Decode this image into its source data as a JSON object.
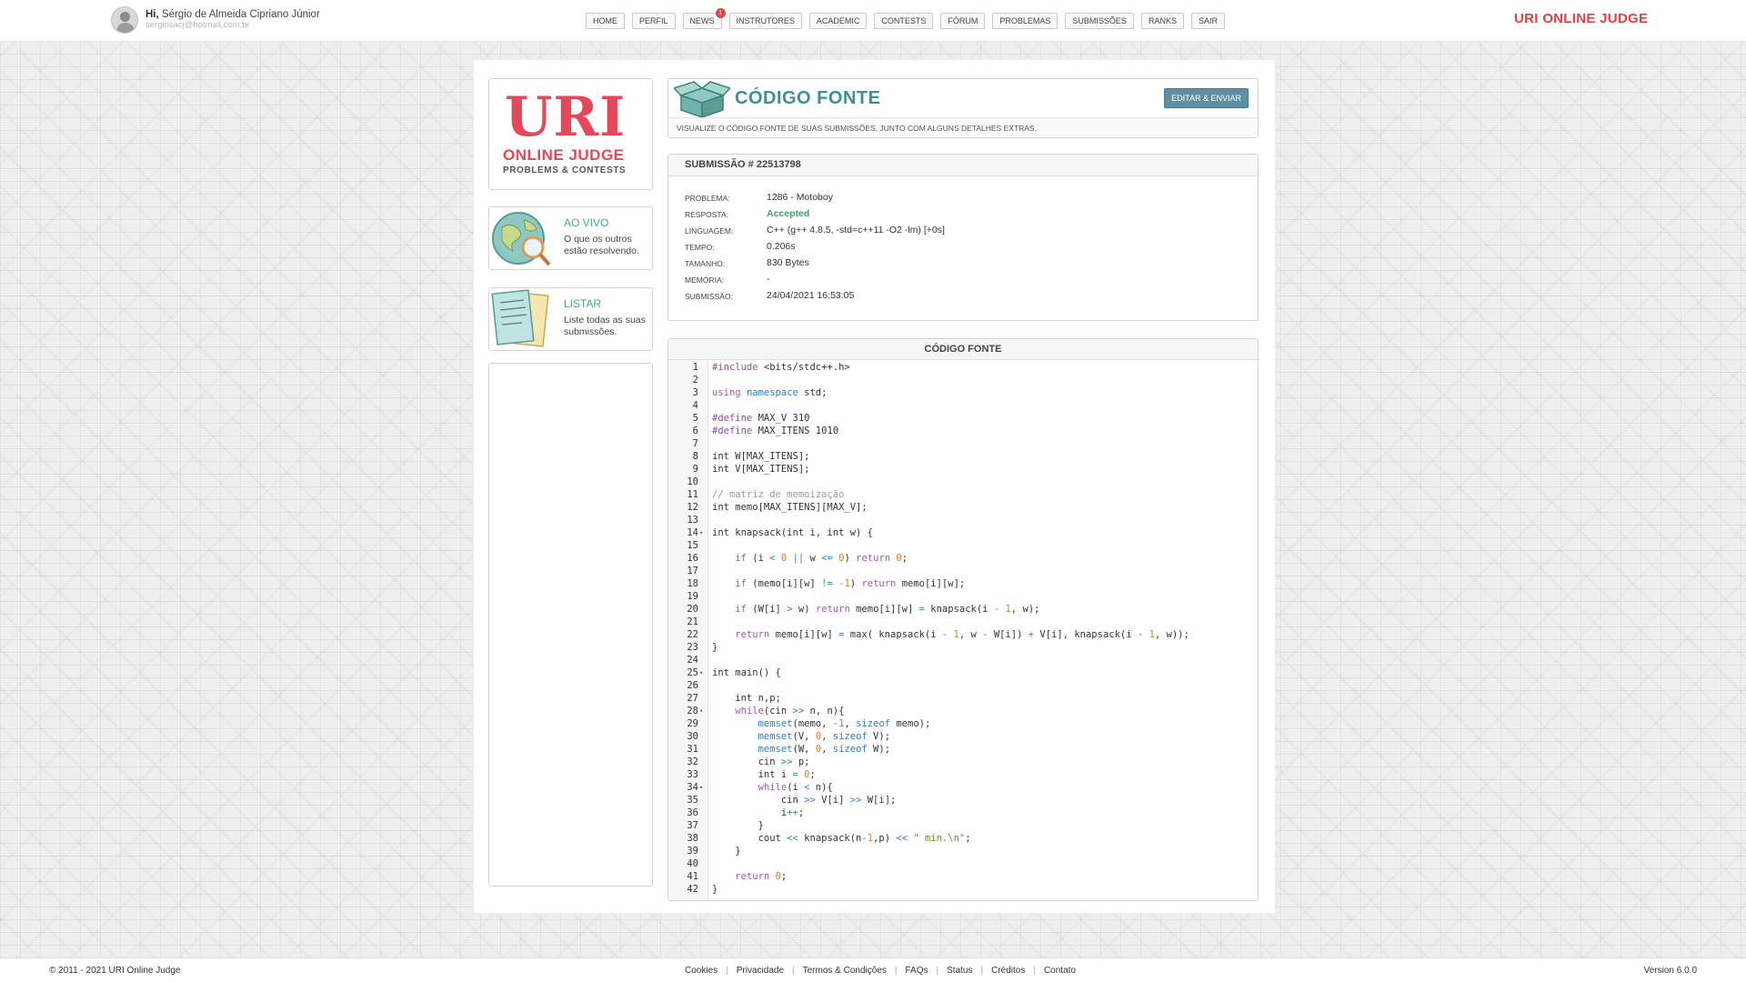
{
  "user": {
    "greeting": "Hi,",
    "name": "Sérgio de Almeida Cipriano Júnior",
    "email": "sergiosacj@hotmail.com.br"
  },
  "nav": {
    "items": [
      {
        "label": "HOME"
      },
      {
        "label": "PERFIL"
      },
      {
        "label": "NEWS",
        "badge": "1"
      },
      {
        "label": "INSTRUTORES"
      },
      {
        "label": "ACADEMIC"
      },
      {
        "label": "CONTESTS"
      },
      {
        "label": "FÓRUM"
      },
      {
        "label": "PROBLEMAS"
      },
      {
        "label": "SUBMISSÕES"
      },
      {
        "label": "RANKS"
      },
      {
        "label": "SAIR"
      }
    ]
  },
  "brand": {
    "top_title": "URI ONLINE JUDGE",
    "color": "#e43f41"
  },
  "logo": {
    "uri": "URI",
    "online_judge": "ONLINE JUDGE",
    "tagline": "PROBLEMS & CONTESTS"
  },
  "sidebar": {
    "live": {
      "title": "AO VIVO",
      "desc": "O que os outros estão resolvendo.",
      "icon": "globe-magnifier-icon"
    },
    "list": {
      "title": "LISTAR",
      "desc": "Liste todas as suas submissões.",
      "icon": "papers-icon"
    }
  },
  "page": {
    "title": "CÓDIGO FONTE",
    "edit_button": "EDITAR & ENVIAR",
    "subtitle": "VISUALIZE O CÓDIGO FONTE DE SUAS SUBMISSÕES, JUNTO COM ALGUNS DETALHES EXTRAS.",
    "title_color": "#3f8f90"
  },
  "submission": {
    "header": "SUBMISSÃO # 22513798",
    "fields": [
      {
        "key": "PROBLEMA:",
        "value": "1286 - Motoboy"
      },
      {
        "key": "RESPOSTA:",
        "value": "Accepted",
        "status": "accepted"
      },
      {
        "key": "LINGUAGEM:",
        "value": "C++ (g++ 4.8.5, -std=c++11 -O2 -lm) [+0s]"
      },
      {
        "key": "TEMPO:",
        "value": "0.206s"
      },
      {
        "key": "TAMANHO:",
        "value": "830 Bytes"
      },
      {
        "key": "MEMÓRIA:",
        "value": "-"
      },
      {
        "key": "SUBMISSÃO:",
        "value": "24/04/2021 16:53:05"
      }
    ],
    "accepted_color": "#27ae60"
  },
  "code": {
    "header": "CÓDIGO FONTE",
    "lines": [
      "#include <bits/stdc++.h>",
      "",
      "using namespace std;",
      "",
      "#define MAX_V 310",
      "#define MAX_ITENS 1010",
      "",
      "int W[MAX_ITENS];",
      "int V[MAX_ITENS];",
      "",
      "// matriz de memoização",
      "int memo[MAX_ITENS][MAX_V];",
      "",
      "int knapsack(int i, int w) {",
      "",
      "    if (i < 0 || w <= 0) return 0;",
      "",
      "    if (memo[i][w] != -1) return memo[i][w];",
      "",
      "    if (W[i] > w) return memo[i][w] = knapsack(i - 1, w);",
      "",
      "    return memo[i][w] = max( knapsack(i - 1, w - W[i]) + V[i], knapsack(i - 1, w));",
      "}",
      "",
      "int main() {",
      "",
      "    int n,p;",
      "    while(cin >> n, n){",
      "        memset(memo, -1, sizeof memo);",
      "        memset(V, 0, sizeof V);",
      "        memset(W, 0, sizeof W);",
      "        cin >> p;",
      "        int i = 0;",
      "        while(i < n){",
      "            cin >> V[i] >> W[i];",
      "            i++;",
      "        }",
      "        cout << knapsack(n-1,p) << \" min.\\n\";",
      "    }",
      "",
      "    return 0;",
      "}"
    ],
    "fold_lines": [
      14,
      25,
      28,
      34
    ]
  },
  "footer": {
    "copyright": "© 2011 - 2021 URI Online Judge",
    "links": [
      "Cookies",
      "Privacidade",
      "Termos & Condições",
      "FAQs",
      "Status",
      "Créditos",
      "Contato"
    ],
    "version": "Version 6.0.0"
  }
}
